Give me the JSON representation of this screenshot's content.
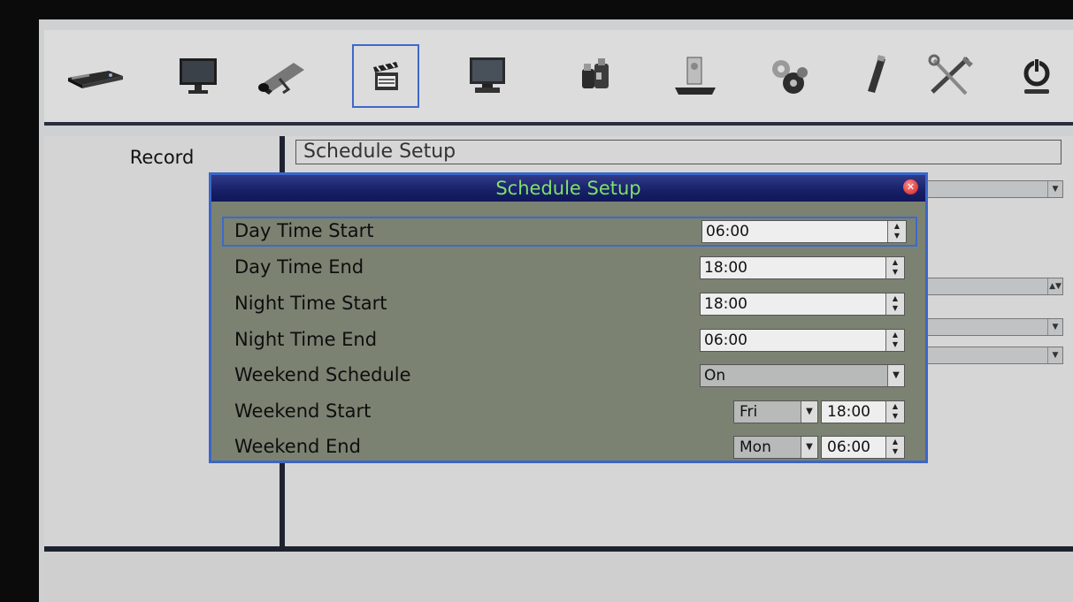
{
  "toolbar": {
    "icons": [
      {
        "name": "dvr-device-icon"
      },
      {
        "name": "monitor-icon"
      },
      {
        "name": "camera-icon"
      },
      {
        "name": "record-clapper-icon"
      },
      {
        "name": "network-computer-icon"
      },
      {
        "name": "alarm-icon"
      },
      {
        "name": "hdd-storage-icon"
      },
      {
        "name": "system-gears-icon"
      },
      {
        "name": "usb-icon"
      },
      {
        "name": "tools-icon"
      },
      {
        "name": "power-icon"
      }
    ]
  },
  "left_panel": {
    "title": "Record"
  },
  "right_panel": {
    "section_title": "Schedule Setup"
  },
  "dialog": {
    "title": "Schedule Setup",
    "rows": [
      {
        "label": "Day Time Start",
        "value": "06:00"
      },
      {
        "label": "Day Time End",
        "value": "18:00"
      },
      {
        "label": "Night Time Start",
        "value": "18:00"
      },
      {
        "label": "Night Time End",
        "value": "06:00"
      },
      {
        "label": "Weekend Schedule",
        "value": "On"
      },
      {
        "label": "Weekend Start",
        "day": "Fri",
        "time": "18:00"
      },
      {
        "label": "Weekend End",
        "day": "Mon",
        "time": "06:00"
      }
    ]
  },
  "colors": {
    "dialog_bg": "#7b8272",
    "dialog_title_text": "#7fe06a",
    "highlight_border": "#3f69c8"
  }
}
